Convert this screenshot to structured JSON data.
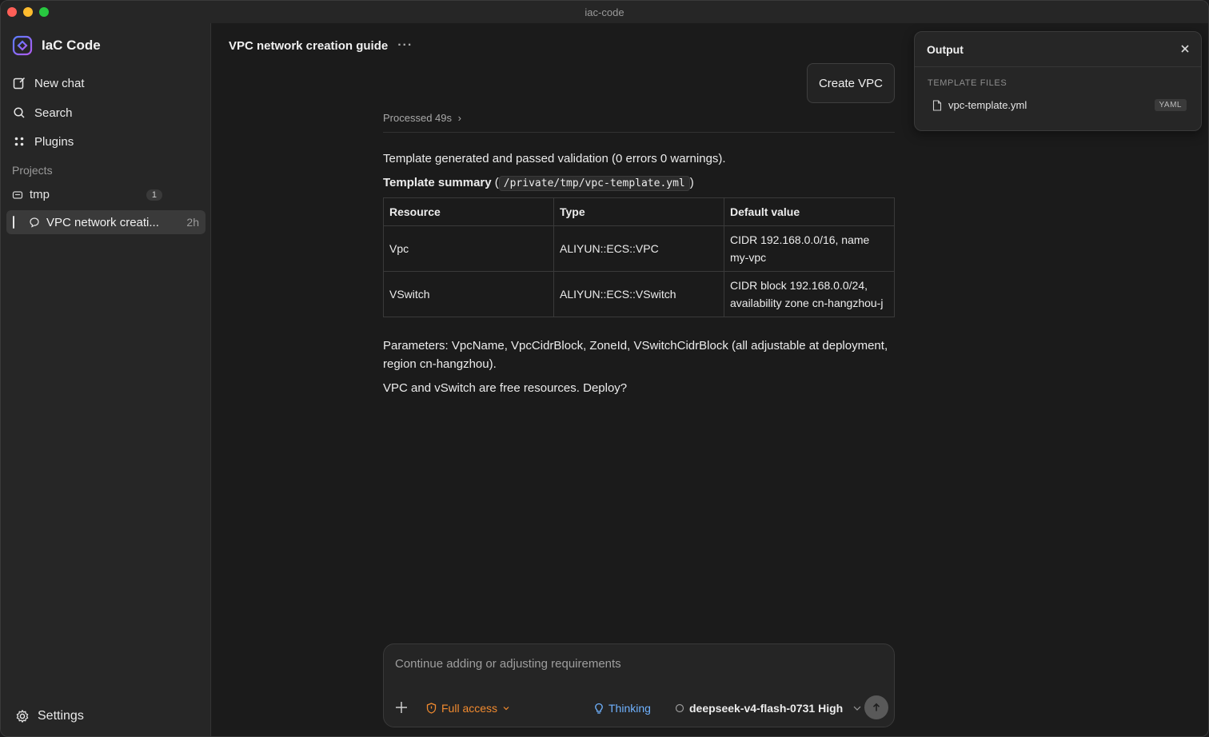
{
  "window": {
    "title": "iac-code"
  },
  "sidebar": {
    "brand": "IaC Code",
    "nav": [
      {
        "label": "New chat",
        "icon": "new-chat-icon"
      },
      {
        "label": "Search",
        "icon": "search-icon"
      },
      {
        "label": "Plugins",
        "icon": "plugins-icon"
      }
    ],
    "projects_label": "Projects",
    "project": {
      "name": "tmp",
      "count": "1"
    },
    "chat": {
      "title": "VPC network creati...",
      "time": "2h"
    },
    "settings_label": "Settings"
  },
  "main": {
    "title": "VPC network creation guide",
    "more": "···",
    "create_vpc_label": "Create VPC",
    "processed": "Processed 49s",
    "processed_chevron": "›",
    "validation_text": "Template generated and passed validation (0 errors 0 warnings).",
    "summary_label": "Template summary",
    "summary_open": "(",
    "summary_path": "/private/tmp/vpc-template.yml",
    "summary_close": ")",
    "table": {
      "headers": [
        "Resource",
        "Type",
        "Default value"
      ],
      "rows": [
        [
          "Vpc",
          "ALIYUN::ECS::VPC",
          "CIDR 192.168.0.0/16, name my-vpc"
        ],
        [
          "VSwitch",
          "ALIYUN::ECS::VSwitch",
          "CIDR block 192.168.0.0/24, availability zone cn-hangzhou-j"
        ]
      ]
    },
    "parameters_text": "Parameters: VpcName, VpcCidrBlock, ZoneId, VSwitchCidrBlock (all adjustable at deployment, region cn-hangzhou).",
    "deploy_text": "VPC and vSwitch are free resources. Deploy?"
  },
  "composer": {
    "placeholder": "Continue adding or adjusting requirements",
    "access_label": "Full access",
    "thinking_label": "Thinking",
    "model_label": "deepseek-v4-flash-0731 High"
  },
  "output": {
    "title": "Output",
    "section": "TEMPLATE FILES",
    "file_name": "vpc-template.yml",
    "file_type": "YAML"
  },
  "colors": {
    "accent_orange": "#f28b2f",
    "accent_blue": "#6fb2ff",
    "background": "#1b1b1b"
  }
}
